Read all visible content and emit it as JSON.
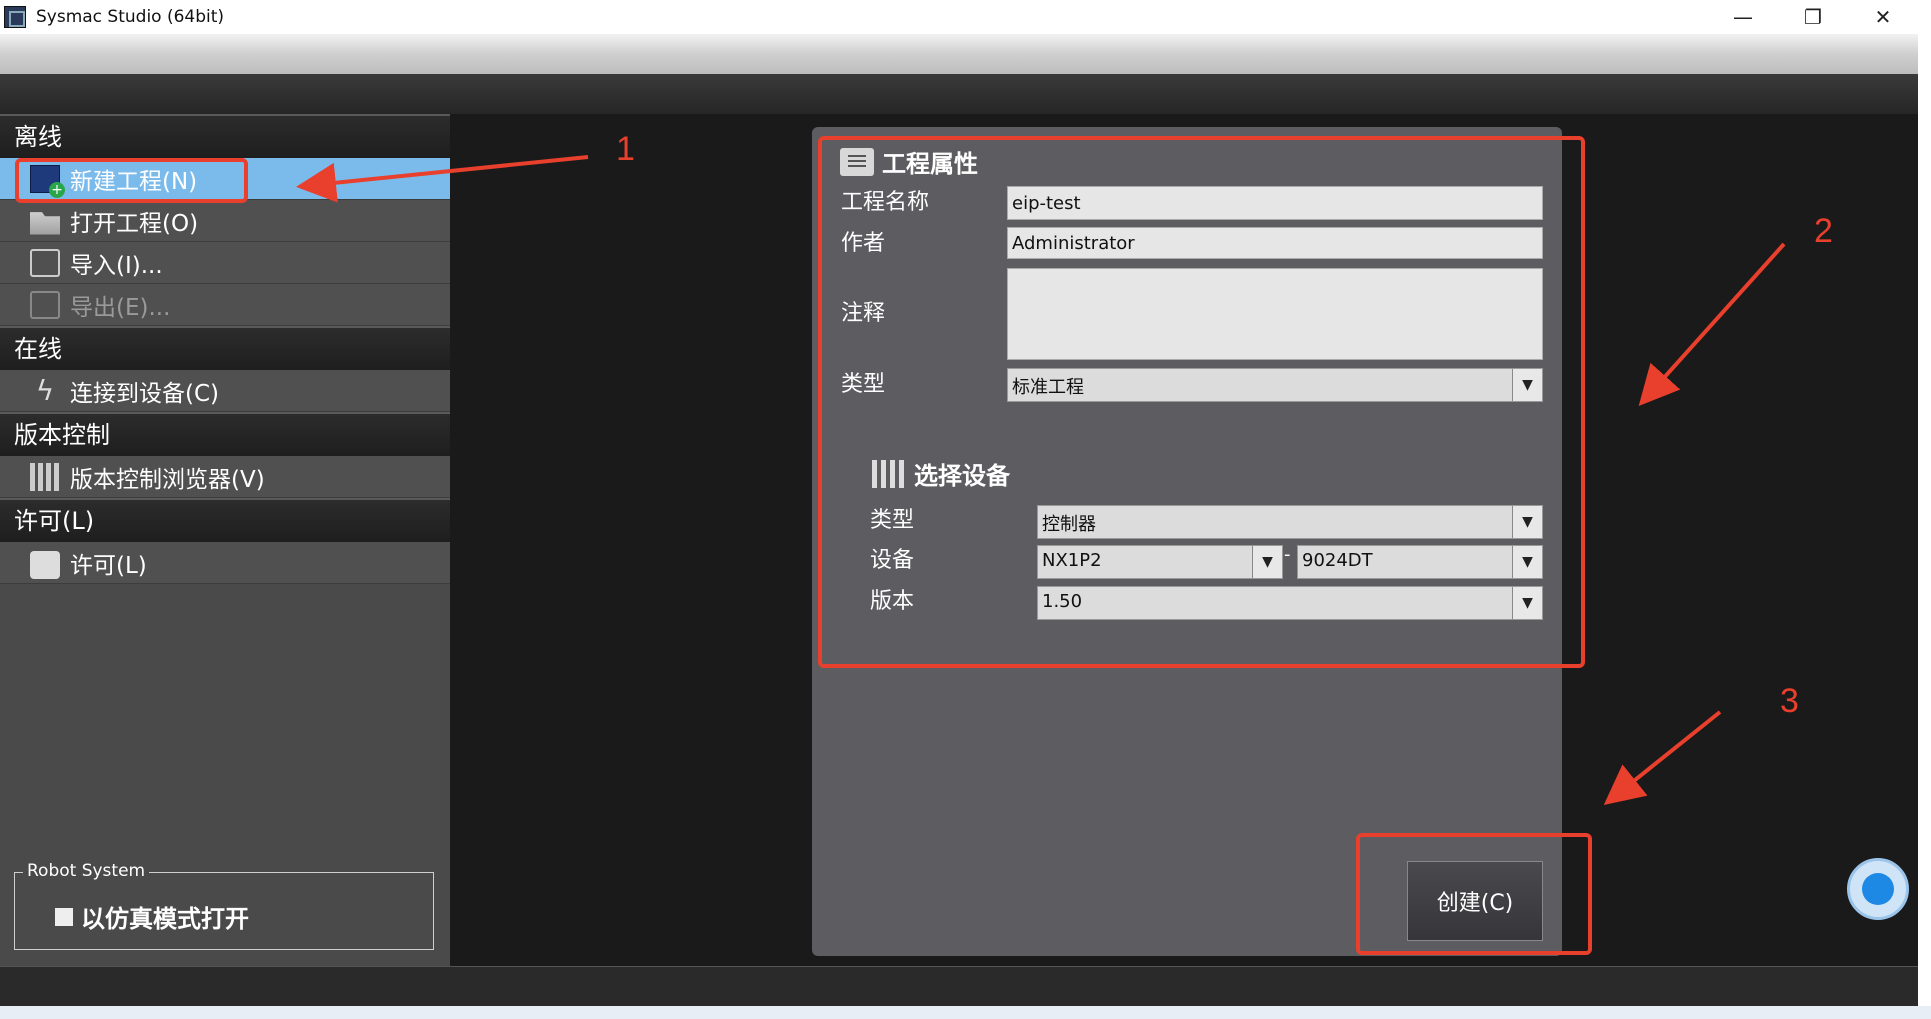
{
  "window": {
    "title": "Sysmac Studio (64bit)",
    "minimize": "—",
    "maximize": "❐",
    "close": "✕"
  },
  "sidebar": {
    "sections": [
      {
        "title": "离线",
        "items": [
          {
            "label": "新建工程(N)",
            "icon": "new-project-icon",
            "state": "selected"
          },
          {
            "label": "打开工程(O)",
            "icon": "folder-icon"
          },
          {
            "label": "导入(I)...",
            "icon": "import-icon"
          },
          {
            "label": "导出(E)...",
            "icon": "export-icon",
            "state": "disabled"
          }
        ]
      },
      {
        "title": "在线",
        "items": [
          {
            "label": "连接到设备(C)",
            "icon": "lightning-icon"
          }
        ]
      },
      {
        "title": "版本控制",
        "items": [
          {
            "label": "版本控制浏览器(V)",
            "icon": "version-control-icon"
          }
        ]
      },
      {
        "title": "许可(L)",
        "items": [
          {
            "label": "许可(L)",
            "icon": "key-icon"
          }
        ]
      }
    ],
    "robot_system": {
      "legend": "Robot System",
      "checkbox_label": "以仿真模式打开"
    }
  },
  "project_properties": {
    "title": "工程属性",
    "name_label": "工程名称",
    "name_value": "eip-test",
    "author_label": "作者",
    "author_value": "Administrator",
    "comment_label": "注释",
    "comment_value": "",
    "type_label": "类型",
    "type_value": "标准工程"
  },
  "select_device": {
    "title": "选择设备",
    "type_label": "类型",
    "type_value": "控制器",
    "device_label": "设备",
    "device_value": "NX1P2",
    "device_separator": "-",
    "device_model_value": "9024DT",
    "version_label": "版本",
    "version_value": "1.50"
  },
  "create_button": "创建(C)",
  "annotations": {
    "n1": "1",
    "n2": "2",
    "n3": "3",
    "color": "#e8402c"
  }
}
